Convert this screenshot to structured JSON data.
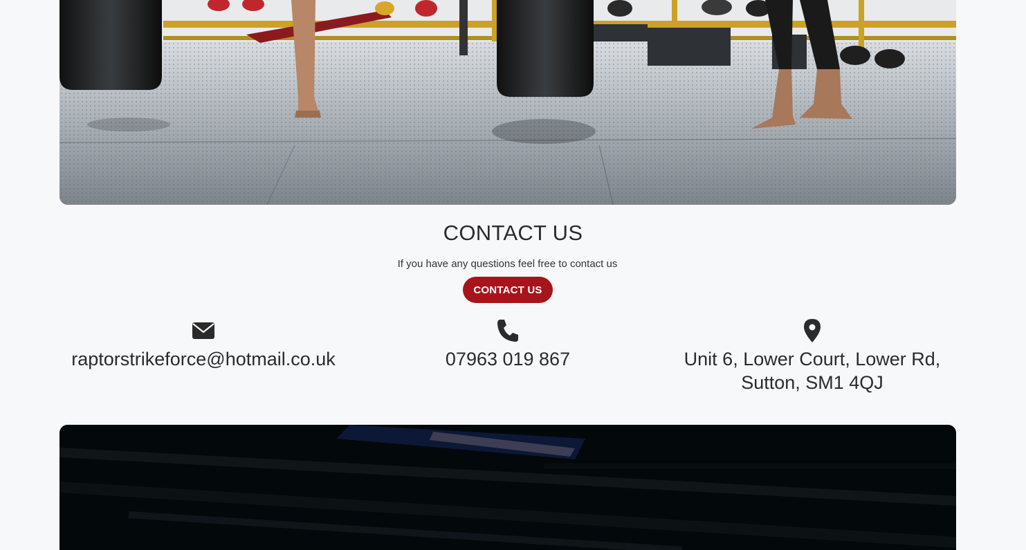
{
  "contact": {
    "title": "CONTACT US",
    "subtitle": "If you have any questions feel free to contact us",
    "button_label": "CONTACT US",
    "accent_color": "#a8141b"
  },
  "info": {
    "email": {
      "icon": "envelope-icon",
      "text": "raptorstrikeforce@hotmail.co.uk"
    },
    "phone": {
      "icon": "phone-icon",
      "text": "07963 019 867"
    },
    "address": {
      "icon": "map-pin-icon",
      "line1": "Unit 6, Lower Court, Lower Rd,",
      "line2": "Sutton, SM1 4QJ"
    }
  },
  "images": {
    "top": "boxing-gym-photo",
    "bottom": "dark-gym-photo"
  }
}
